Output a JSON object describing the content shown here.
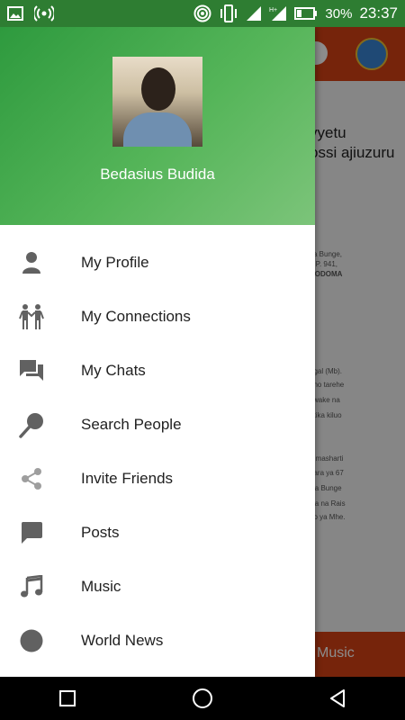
{
  "status_bar": {
    "battery_percent": "30%",
    "time": "23:37",
    "icons": [
      "image-icon",
      "broadcast-icon",
      "hotspot-icon",
      "vibrate-icon",
      "signal-icon",
      "signal-h-icon",
      "battery-icon"
    ]
  },
  "background": {
    "title_line1": "vyetu",
    "title_line2": "ossi ajiuzuru",
    "doc_lines": [
      "ya Bunge,",
      "L.P. 941,",
      "DODOMA",
      "ugal (Mb).",
      "ano tarehe",
      "kwake na",
      "atika  kiluo",
      "a masharti",
      "bara ya 67",
      "wa  Bunge",
      "wa na Rais",
      "do ya Mhe."
    ],
    "bottom_label": "Music",
    "colors": {
      "toolbar": "#d84315",
      "scrim": "rgba(0,0,0,0.45)"
    }
  },
  "drawer": {
    "user_name": "Bedasius Budida",
    "header_colors": [
      "#2e9a3e",
      "#7cc47a"
    ],
    "items": [
      {
        "label": "My Profile",
        "icon": "person-icon"
      },
      {
        "label": "My Connections",
        "icon": "people-icon"
      },
      {
        "label": "My Chats",
        "icon": "chat-icon"
      },
      {
        "label": "Search People",
        "icon": "search-icon"
      },
      {
        "label": "Invite Friends",
        "icon": "share-icon"
      },
      {
        "label": "Posts",
        "icon": "post-icon"
      },
      {
        "label": "Music",
        "icon": "music-icon"
      },
      {
        "label": "World News",
        "icon": "globe-icon"
      }
    ]
  },
  "nav_bar": {
    "buttons": [
      "recents-icon",
      "home-icon",
      "back-icon"
    ]
  }
}
